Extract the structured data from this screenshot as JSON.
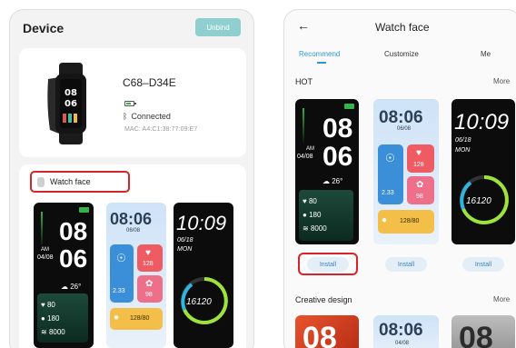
{
  "left": {
    "title": "Device",
    "unbind_label": "Unbind",
    "device_name": "C68–D34E",
    "status": "Connected",
    "mac": "MAC: A4:C1:38:77:09:E7",
    "watch_face_label": "Watch face",
    "faces": [
      {
        "hour": "08",
        "minute": "06",
        "ampm": "AM",
        "date": "04/08",
        "temp": "26°",
        "hr": "80",
        "kcal": "180",
        "steps": "8000"
      },
      {
        "time": "08:06",
        "date": "06/08",
        "v1": "128",
        "v2": "2.33",
        "v3": "98",
        "v4": "128/80"
      },
      {
        "time": "10:09",
        "date": "06/18",
        "day": "MON",
        "steps": "16120"
      }
    ]
  },
  "right": {
    "title": "Watch face",
    "tabs": [
      "Recommend",
      "Customize",
      "Me"
    ],
    "hot_label": "HOT",
    "more_label": "More",
    "install_label": "Install",
    "creative_label": "Creative design",
    "creative_more": "More",
    "creative_faces": [
      {
        "text": "08"
      },
      {
        "time": "08:06",
        "date": "04/08"
      },
      {
        "text": "08"
      }
    ],
    "faces": [
      {
        "hour": "08",
        "minute": "06",
        "ampm": "AM",
        "date": "04/08",
        "temp": "26°",
        "hr": "80",
        "kcal": "180",
        "steps": "8000"
      },
      {
        "time": "08:06",
        "date": "06/08",
        "v1": "128",
        "v2": "2.33",
        "v3": "98",
        "v4": "128/80"
      },
      {
        "time": "10:09",
        "date": "06/18",
        "day": "MON",
        "steps": "16120"
      }
    ]
  },
  "colors": {
    "accent": "#2a98d6",
    "highlight": "#d8232a",
    "unbind": "#8fcfd0",
    "green": "#38b14a"
  }
}
